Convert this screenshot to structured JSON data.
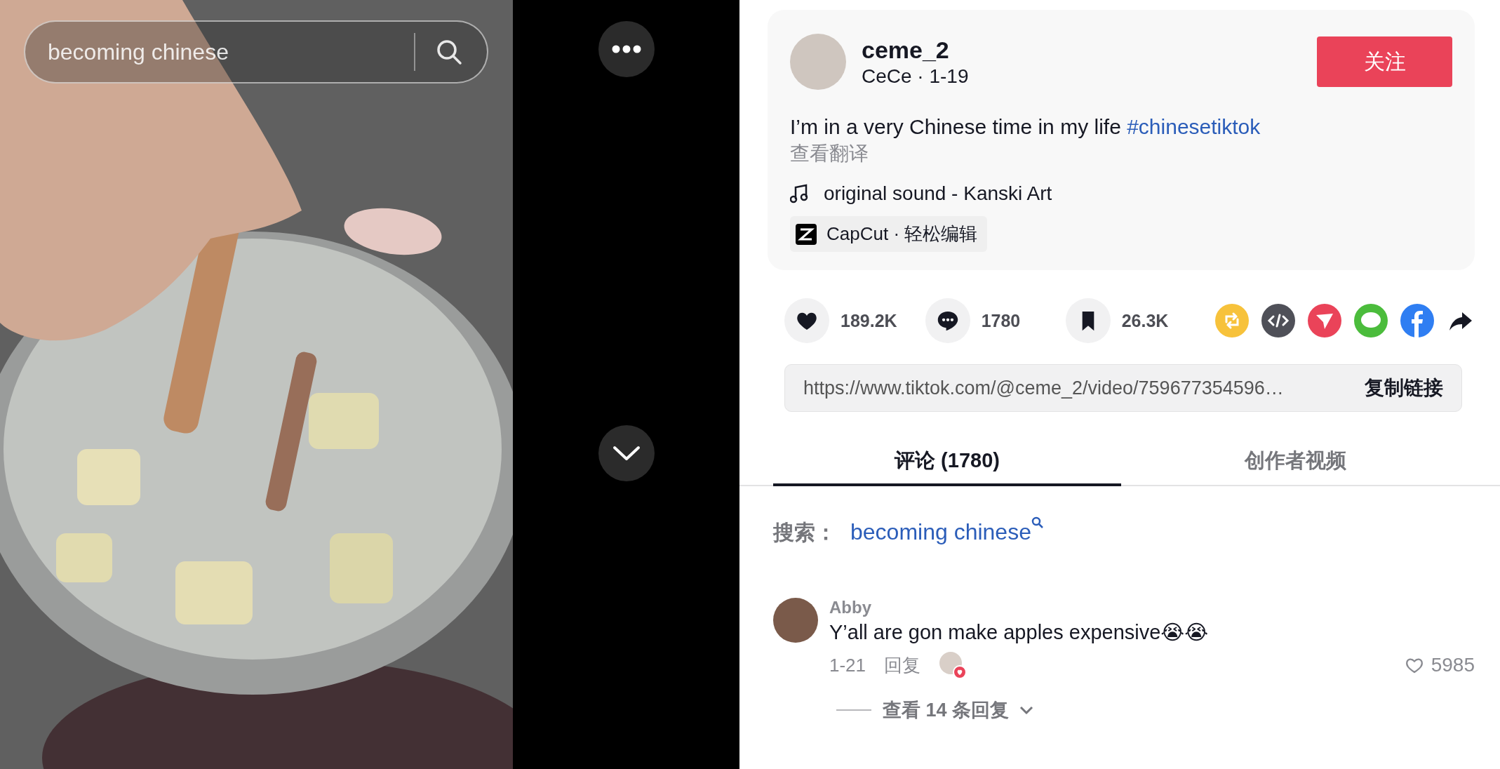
{
  "video": {
    "search": {
      "value": "becoming chinese"
    }
  },
  "author": {
    "username": "ceme_2",
    "meta": "CeCe · 1-19",
    "follow_button": "关注"
  },
  "caption": {
    "text": "I’m in a very Chinese time in my life",
    "hashtag": "#chinesetiktok",
    "translate": "查看翻译"
  },
  "sound": "original sound - Kanski Art",
  "capcut": "CapCut · 轻松编辑",
  "stats": [
    {
      "kind": "like",
      "count": "189.2K"
    },
    {
      "kind": "comment",
      "count": "1780"
    },
    {
      "kind": "save",
      "count": "26.3K"
    }
  ],
  "link": {
    "url": "https://www.tiktok.com/@ceme_2/video/759677354596…",
    "copy_button": "复制链接"
  },
  "tabs": [
    {
      "label": "评论 (1780)",
      "selected": true
    },
    {
      "label": "创作者视频",
      "selected": false
    }
  ],
  "search_suggestion": {
    "label": "搜索：",
    "query": "becoming chinese"
  },
  "comments": [
    {
      "author": "Abby",
      "text": "Y’all are gon make apples expensive😭😭",
      "date": "1-21",
      "reply": "回复",
      "liked_by_creator": true,
      "likes": "5985",
      "view_replies": "查看 14 条回复"
    }
  ]
}
